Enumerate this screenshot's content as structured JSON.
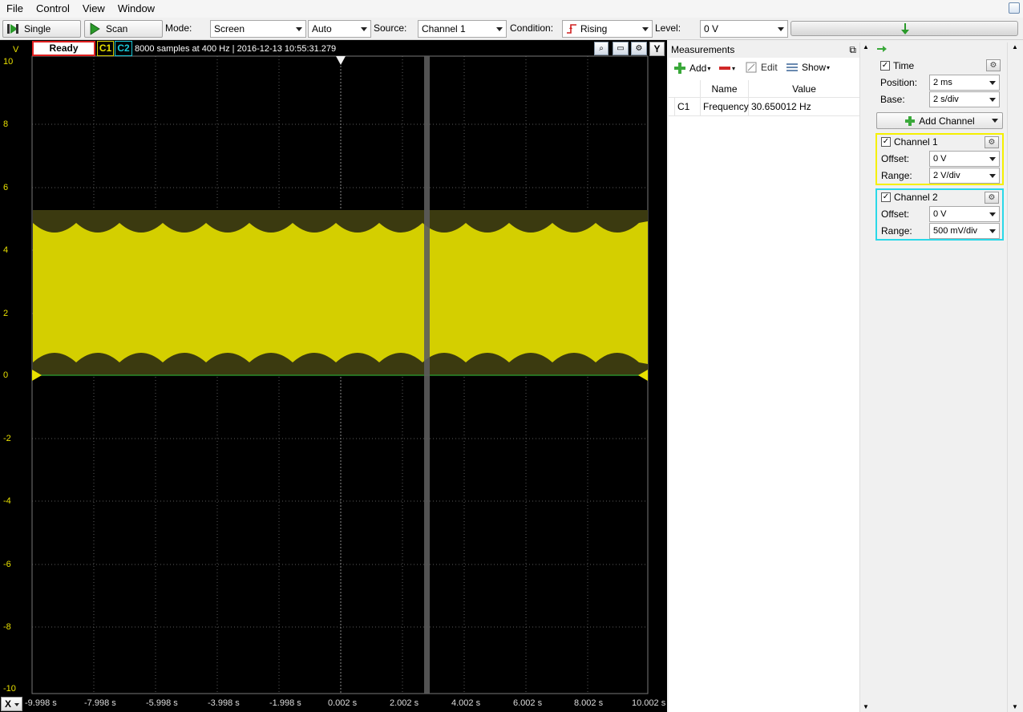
{
  "menu": [
    "File",
    "Control",
    "View",
    "Window"
  ],
  "toolbar": {
    "single_label": "Single",
    "scan_label": "Scan",
    "mode_label": "Mode:",
    "mode_value": "Screen",
    "auto_value": "Auto",
    "source_label": "Source:",
    "source_value": "Channel 1",
    "condition_label": "Condition:",
    "condition_value": "Rising",
    "level_label": "Level:",
    "level_value": "0 V"
  },
  "scope": {
    "status": "Ready",
    "c1": "C1",
    "c2": "C2",
    "info": "8000 samples at 400 Hz | 2016-12-13 10:55:31.279",
    "y_unit": "V",
    "y_button": "Y",
    "x_button": "X",
    "y_ticks": [
      "10",
      "8",
      "6",
      "4",
      "2",
      "0",
      "-2",
      "-4",
      "-6",
      "-8",
      "-10"
    ],
    "x_ticks": [
      "-9.998 s",
      "-7.998 s",
      "-5.998 s",
      "-3.998 s",
      "-1.998 s",
      "0.002 s",
      "2.002 s",
      "4.002 s",
      "6.002 s",
      "8.002 s",
      "10.002 s"
    ],
    "colors": {
      "channel1": "#d4cf00",
      "channel2": "#19c8d8",
      "status_border": "#e02020",
      "background": "#000000"
    }
  },
  "measurements": {
    "title": "Measurements",
    "add_label": "Add",
    "edit_label": "Edit",
    "show_label": "Show",
    "columns": [
      "Name",
      "Value"
    ],
    "rows": [
      {
        "ch": "C1",
        "name": "Frequency",
        "value": "30.650012 Hz"
      }
    ]
  },
  "time": {
    "title": "Time",
    "position_label": "Position:",
    "position_value": "2 ms",
    "base_label": "Base:",
    "base_value": "2 s/div"
  },
  "add_channel_label": "Add Channel",
  "channel1": {
    "title": "Channel 1",
    "offset_label": "Offset:",
    "offset_value": "0 V",
    "range_label": "Range:",
    "range_value": "2 V/div"
  },
  "channel2": {
    "title": "Channel 2",
    "offset_label": "Offset:",
    "offset_value": "0 V",
    "range_label": "Range:",
    "range_value": "500 mV/div"
  }
}
